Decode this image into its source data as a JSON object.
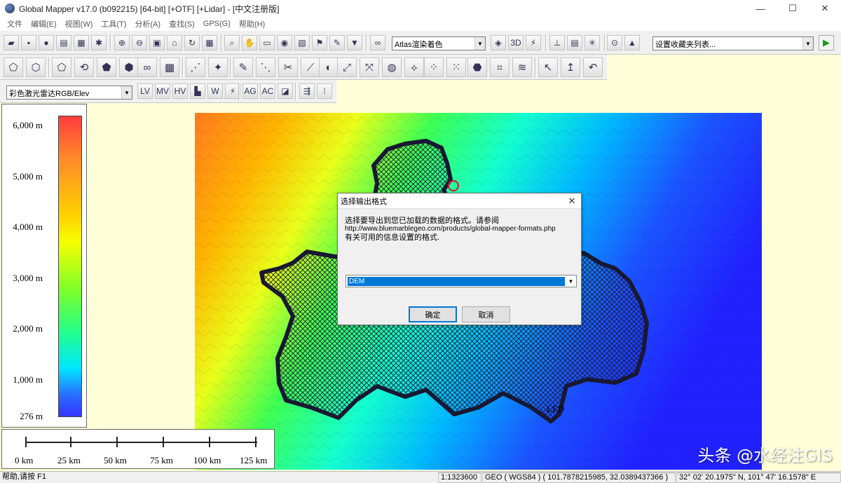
{
  "window": {
    "title": "Global Mapper v17.0 (b092215) [64-bit] [+OTF] [+Lidar] - [中文注册版]",
    "minimize": "—",
    "maximize": "☐",
    "close": "✕"
  },
  "menu": [
    {
      "label": "文件"
    },
    {
      "label": "编辑(E)"
    },
    {
      "label": "视图(W)"
    },
    {
      "label": "工具(T)"
    },
    {
      "label": "分析(A)"
    },
    {
      "label": "查找(S)"
    },
    {
      "label": "GPS(G)"
    },
    {
      "label": "帮助(H)"
    }
  ],
  "toolbar": {
    "shader_select": "Atlas渲染着色",
    "bookmark_select": "设置收藏夹列表...",
    "play_label": "▶",
    "lidar_select": "彩色激光雷达RGB/Elev"
  },
  "legend": {
    "labels": [
      "6,000 m",
      "5,000 m",
      "4,000 m",
      "3,000 m",
      "2,000 m",
      "1,000 m",
      "276 m"
    ],
    "max": 6000,
    "min": 276,
    "values": [
      6000,
      5000,
      4000,
      3000,
      2000,
      1000,
      276
    ]
  },
  "scalebar": {
    "labels": [
      "0 km",
      "25 km",
      "50 km",
      "75 km",
      "100 km",
      "125 km"
    ]
  },
  "dialog": {
    "title": "选择输出格式",
    "line1": "选择要导出到您已加载的数据的格式。请参阅",
    "url": "http://www.bluemarblegeo.com/products/global-mapper-formats.php",
    "line2": "有关可用的信息设置的格式.",
    "format_selected": "DEM",
    "ok_label": "确定",
    "cancel_label": "取消",
    "close_label": "✕"
  },
  "map": {
    "feature_label": "LED",
    "watermark": "头条 @水经注GIS"
  },
  "status": {
    "help": "帮助,请按 F1",
    "scale": "1:1323600",
    "coords": "GEO ( WGS84 ) ( 101.7878215985, 32.0389437366 )",
    "dms": "32° 02' 20.1975\" N, 101° 47' 16.1578\" E"
  },
  "colors": {
    "dialog_select": "#0078d7",
    "ok_border": "#0078d7",
    "polygon_hatch": "#1a1a2e",
    "boundary": "#181832"
  }
}
